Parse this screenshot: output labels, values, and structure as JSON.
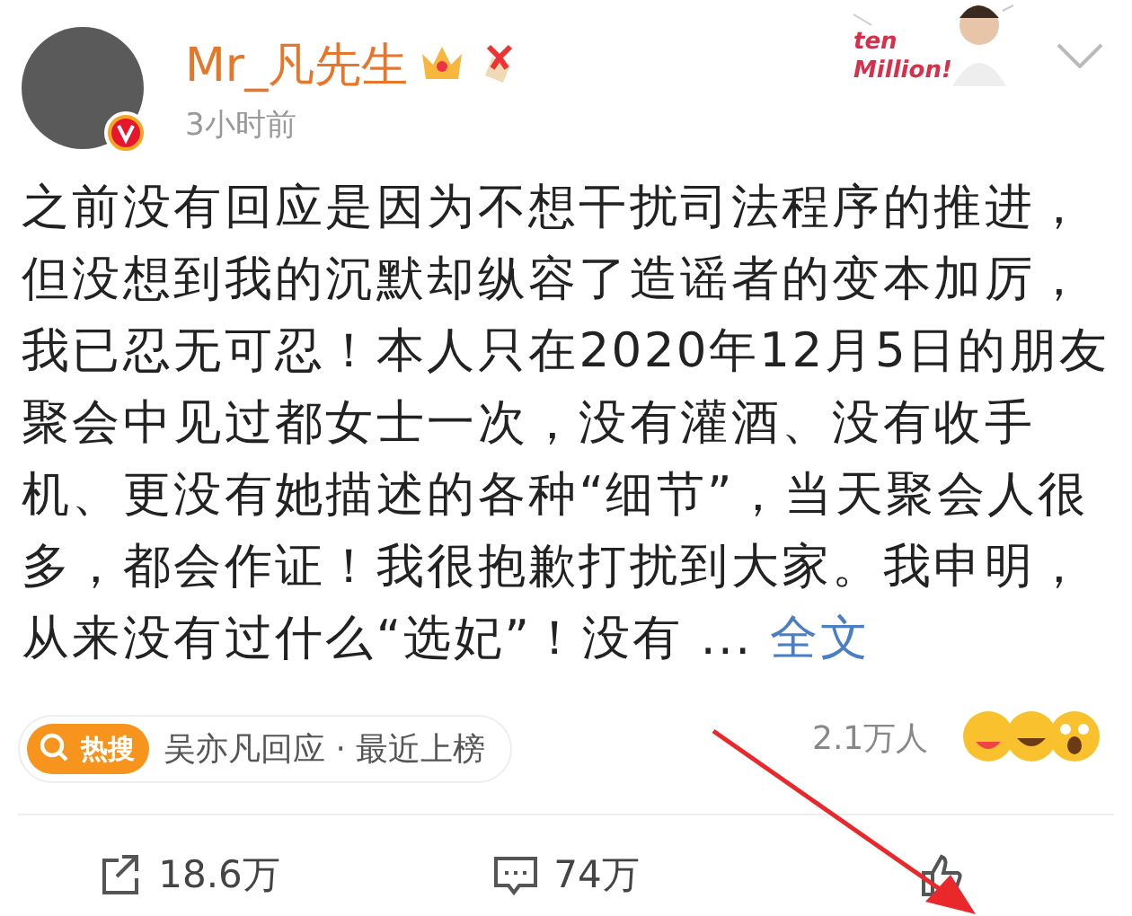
{
  "post": {
    "author": "Mr_凡先生",
    "time": "3小时前",
    "sticker_text": "ten Million!",
    "body": "之前没有回应是因为不想干扰司法程序的推进，但没想到我的沉默却纵容了造谣者的变本加厉，我已忍无可忍！本人只在2020年12月5日的朋友聚会中见过都女士一次，没有灌酒、没有收手机、更没有她描述的各种“细节”，当天聚会人很多，都会作证！我很抱歉打扰到大家。我申明，从来没有过什么“选妃”！没有 ...",
    "more_link": "全文"
  },
  "hot_search": {
    "badge": "热搜",
    "topic": "吴亦凡回应 · 最近上榜",
    "count": "2.1万人"
  },
  "actions": [
    {
      "kind": "share",
      "count": "18.6万"
    },
    {
      "kind": "comment",
      "count": "74万"
    },
    {
      "kind": "like"
    }
  ]
}
